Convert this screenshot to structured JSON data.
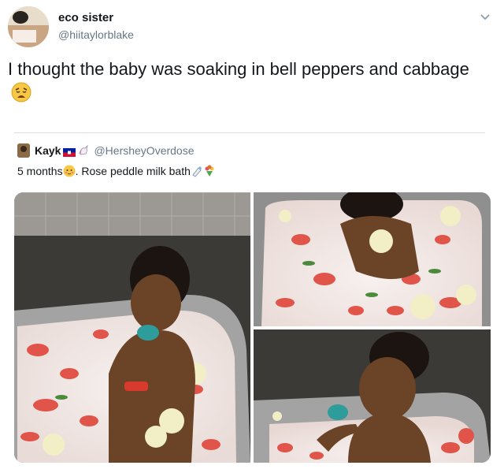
{
  "tweet": {
    "display_name": "eco sister",
    "handle": "@hiitaylorblake",
    "text": "I thought the baby was soaking in bell peppers and cabbage",
    "emoji": "weary-face-icon"
  },
  "quoted": {
    "display_name": "Kayk",
    "handle": "@HersheyOverdose",
    "text_prefix": "5 months",
    "text_suffix": ". Rose peddle milk bath",
    "icons": [
      "haiti-flag-icon",
      "unicorn-icon",
      "blushing-face-icon",
      "milk-bottle-icon",
      "rose-bouquet-icon"
    ]
  },
  "media": {
    "photos": [
      "baby-in-sink-photo-1",
      "baby-in-sink-photo-2",
      "baby-in-sink-photo-3"
    ]
  },
  "colors": {
    "text": "#14171a",
    "secondary": "#657786",
    "milk": "#f3ece8",
    "petal": "#e0544a",
    "sink": "#9a9a9a",
    "granite": "#3a3a38"
  }
}
